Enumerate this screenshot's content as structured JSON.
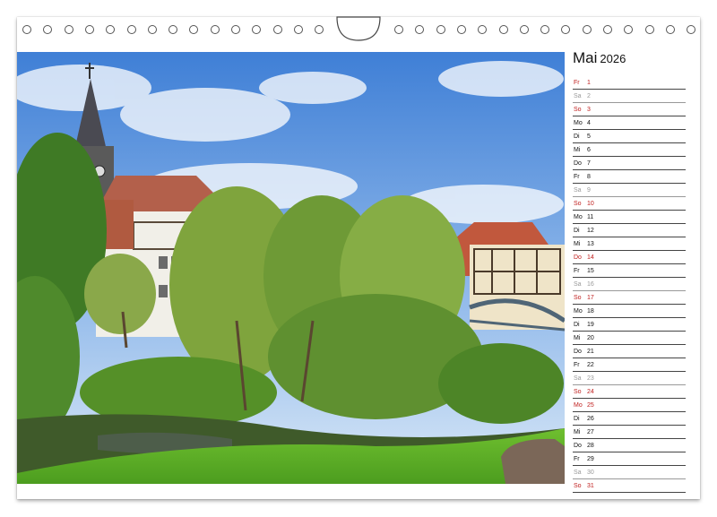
{
  "calendar": {
    "month": "Mai",
    "year": "2026",
    "days": [
      {
        "abbr": "Fr",
        "num": "1",
        "type": "hol"
      },
      {
        "abbr": "Sa",
        "num": "2",
        "type": "sat"
      },
      {
        "abbr": "So",
        "num": "3",
        "type": "sun"
      },
      {
        "abbr": "Mo",
        "num": "4",
        "type": "wd"
      },
      {
        "abbr": "Di",
        "num": "5",
        "type": "wd"
      },
      {
        "abbr": "Mi",
        "num": "6",
        "type": "wd"
      },
      {
        "abbr": "Do",
        "num": "7",
        "type": "wd"
      },
      {
        "abbr": "Fr",
        "num": "8",
        "type": "wd"
      },
      {
        "abbr": "Sa",
        "num": "9",
        "type": "sat"
      },
      {
        "abbr": "So",
        "num": "10",
        "type": "sun"
      },
      {
        "abbr": "Mo",
        "num": "11",
        "type": "wd"
      },
      {
        "abbr": "Di",
        "num": "12",
        "type": "wd"
      },
      {
        "abbr": "Mi",
        "num": "13",
        "type": "wd"
      },
      {
        "abbr": "Do",
        "num": "14",
        "type": "hol"
      },
      {
        "abbr": "Fr",
        "num": "15",
        "type": "wd"
      },
      {
        "abbr": "Sa",
        "num": "16",
        "type": "sat"
      },
      {
        "abbr": "So",
        "num": "17",
        "type": "sun"
      },
      {
        "abbr": "Mo",
        "num": "18",
        "type": "wd"
      },
      {
        "abbr": "Di",
        "num": "19",
        "type": "wd"
      },
      {
        "abbr": "Mi",
        "num": "20",
        "type": "wd"
      },
      {
        "abbr": "Do",
        "num": "21",
        "type": "wd"
      },
      {
        "abbr": "Fr",
        "num": "22",
        "type": "wd"
      },
      {
        "abbr": "Sa",
        "num": "23",
        "type": "sat"
      },
      {
        "abbr": "So",
        "num": "24",
        "type": "sun"
      },
      {
        "abbr": "Mo",
        "num": "25",
        "type": "hol"
      },
      {
        "abbr": "Di",
        "num": "26",
        "type": "wd"
      },
      {
        "abbr": "Mi",
        "num": "27",
        "type": "wd"
      },
      {
        "abbr": "Do",
        "num": "28",
        "type": "wd"
      },
      {
        "abbr": "Fr",
        "num": "29",
        "type": "wd"
      },
      {
        "abbr": "Sa",
        "num": "30",
        "type": "sat"
      },
      {
        "abbr": "So",
        "num": "31",
        "type": "sun"
      }
    ]
  },
  "colors": {
    "holiday": "#c0201f",
    "saturday": "#9a9a9a",
    "weekday": "#111111"
  }
}
